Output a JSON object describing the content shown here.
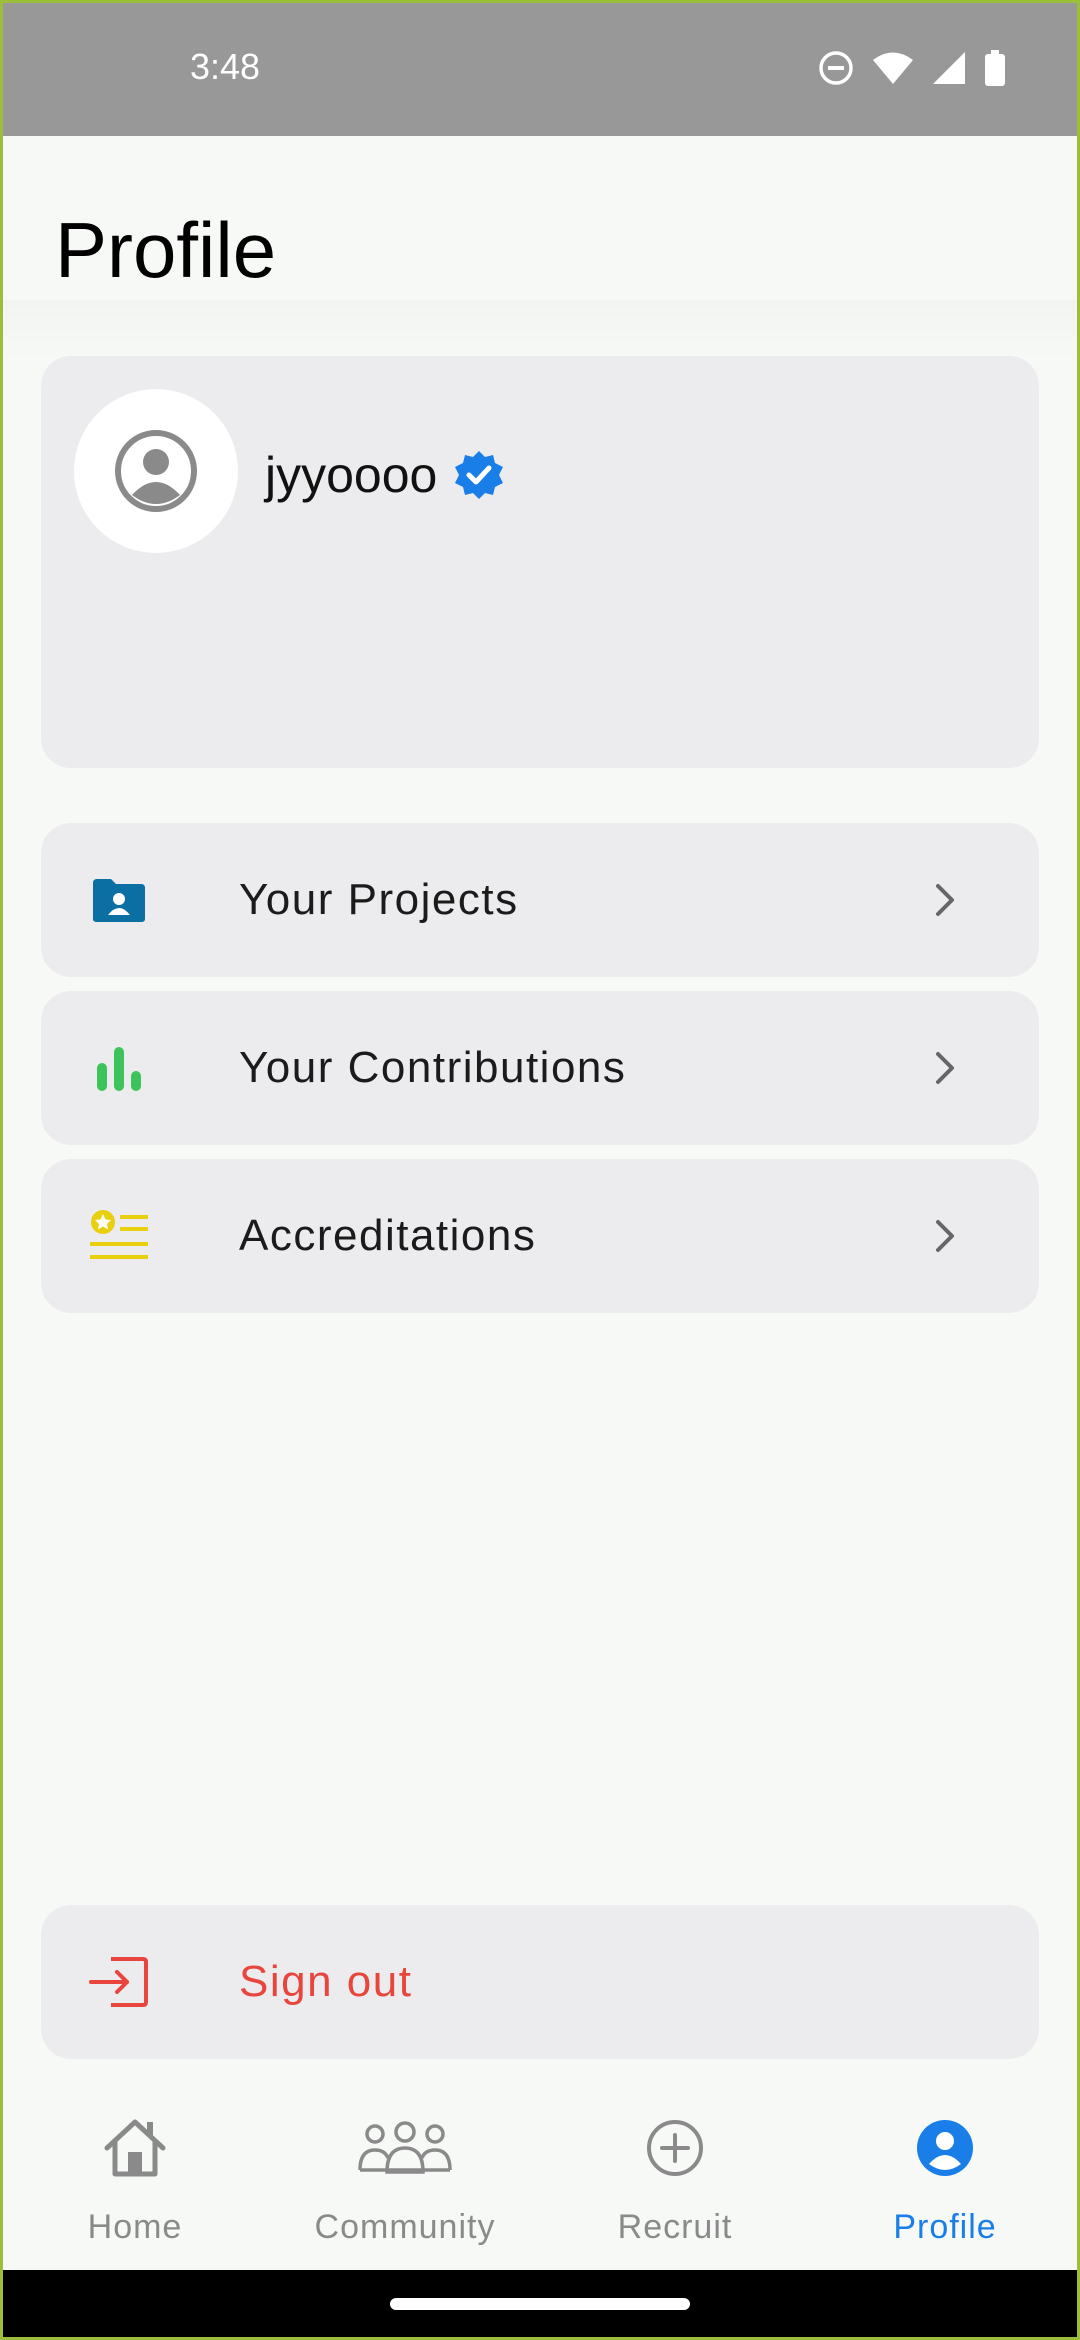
{
  "status": {
    "time": "3:48"
  },
  "page": {
    "title": "Profile"
  },
  "profile": {
    "username": "jyyoooo"
  },
  "menu": [
    {
      "label": "Your Projects",
      "icon": "folder-user-icon",
      "color": "#0b6fa4"
    },
    {
      "label": "Your Contributions",
      "icon": "bar-chart-icon",
      "color": "#3cc45a"
    },
    {
      "label": "Accreditations",
      "icon": "accreditation-icon",
      "color": "#e8cf10"
    }
  ],
  "signout": {
    "label": "Sign out",
    "color": "#e8453c"
  },
  "nav": [
    {
      "label": "Home",
      "icon": "home-icon"
    },
    {
      "label": "Community",
      "icon": "community-icon"
    },
    {
      "label": "Recruit",
      "icon": "plus-circle-icon"
    },
    {
      "label": "Profile",
      "icon": "profile-icon",
      "active": true
    }
  ],
  "colors": {
    "accent": "#1a7ee8",
    "verified": "#1a7ee8"
  }
}
